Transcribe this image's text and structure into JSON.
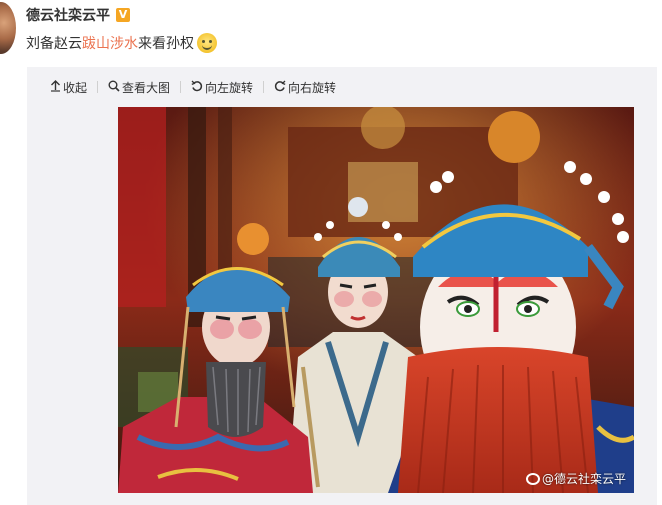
{
  "post": {
    "author": "德云社栾云平",
    "text_before": "刘备赵云",
    "topic": "跋山涉水",
    "text_after": "来看孙权"
  },
  "colors": {
    "topic_link": "#eb7350",
    "badge": "#f5a623",
    "media_background": "#f2f2f5"
  },
  "toolbar": {
    "collapse_label": "收起",
    "view_large_label": "查看大图",
    "rotate_left_label": "向左旋转",
    "rotate_right_label": "向右旋转"
  },
  "icons": {
    "collapse": "arrow-up-icon",
    "view_large": "magnifier-icon",
    "rotate_left": "rotate-left-icon",
    "rotate_right": "rotate-right-icon",
    "verified": "vip-badge-icon",
    "emoji": "smile-emoji-icon"
  },
  "photo": {
    "watermark": "@德云社栾云平"
  }
}
